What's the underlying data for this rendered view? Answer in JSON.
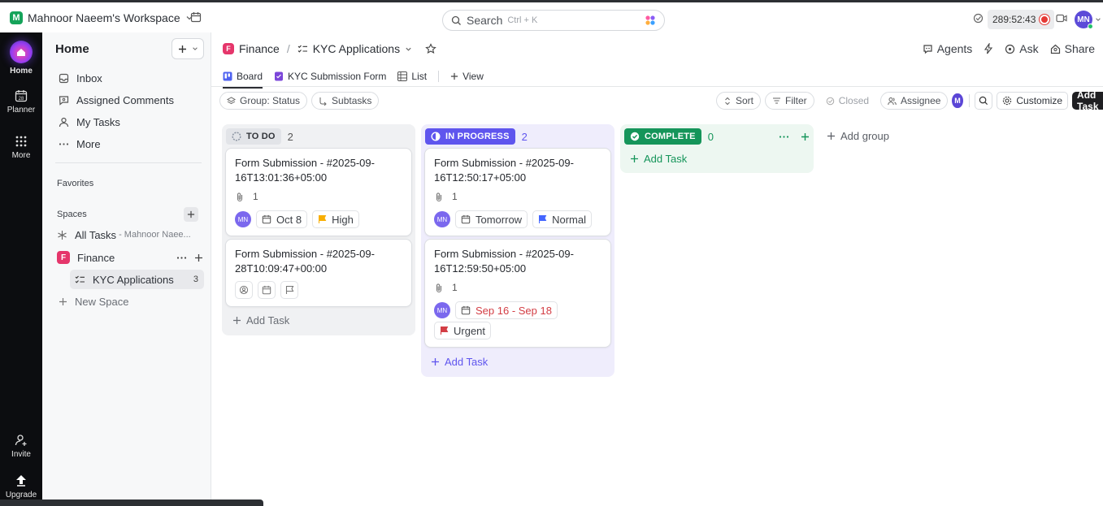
{
  "workspace": {
    "badge": "M",
    "name": "Mahnoor Naeem's Workspace"
  },
  "search": {
    "placeholder": "Search",
    "shortcut": "Ctrl + K"
  },
  "timer": {
    "value": "289:52:43"
  },
  "user": {
    "initials": "MN"
  },
  "rail": {
    "items": [
      {
        "label": "Home"
      },
      {
        "label": "Planner",
        "date": "28"
      },
      {
        "label": "More"
      },
      {
        "label": "Invite"
      },
      {
        "label": "Upgrade"
      }
    ]
  },
  "sidebar": {
    "title": "Home",
    "nav": [
      {
        "label": "Inbox"
      },
      {
        "label": "Assigned Comments"
      },
      {
        "label": "My Tasks"
      },
      {
        "label": "More"
      }
    ],
    "favorites_label": "Favorites",
    "spaces_label": "Spaces",
    "all_tasks": {
      "label": "All Tasks",
      "sub": "- Mahnoor Naee..."
    },
    "finance": {
      "badge": "F",
      "label": "Finance"
    },
    "kyc": {
      "label": "KYC Applications",
      "count": "3"
    },
    "new_space": "New Space"
  },
  "breadcrumb": {
    "space_badge": "F",
    "space": "Finance",
    "sep": "/",
    "list": "KYC Applications"
  },
  "header_actions": {
    "agents": "Agents",
    "ask": "Ask",
    "share": "Share"
  },
  "tabs": [
    {
      "label": "Board"
    },
    {
      "label": "KYC Submission Form"
    },
    {
      "label": "List"
    },
    {
      "label": "View"
    }
  ],
  "toolbar": {
    "group": "Group: Status",
    "subtasks": "Subtasks",
    "sort": "Sort",
    "filter": "Filter",
    "closed": "Closed",
    "assignee": "Assignee",
    "me_badge": "M",
    "customize": "Customize",
    "add_task": "Add Task"
  },
  "columns": [
    {
      "status": "TO DO",
      "count": "2",
      "add_task": "Add Task",
      "cards": [
        {
          "title": "Form Submission - #2025-09-16T13:01:36+05:00",
          "attachments": "1",
          "assignee": "MN",
          "date": "Oct 8",
          "priority": "High"
        },
        {
          "title": "Form Submission - #2025-09-28T10:09:47+00:00"
        }
      ]
    },
    {
      "status": "IN PROGRESS",
      "count": "2",
      "add_task": "Add Task",
      "cards": [
        {
          "title": "Form Submission - #2025-09-16T12:50:17+05:00",
          "attachments": "1",
          "assignee": "MN",
          "date": "Tomorrow",
          "priority": "Normal"
        },
        {
          "title": "Form Submission - #2025-09-16T12:59:50+05:00",
          "attachments": "1",
          "assignee": "MN",
          "date": "Sep 16 - Sep 18",
          "priority": "Urgent"
        }
      ]
    },
    {
      "status": "COMPLETE",
      "count": "0",
      "add_task": "Add Task"
    }
  ],
  "add_group": "Add group",
  "colors": {
    "todo": "#87909e",
    "inprogress": "#5f55ee",
    "complete": "#0f9d58",
    "high": "#f8ae00",
    "normal": "#4466ff",
    "urgent": "#d33d44",
    "overdue": "#d33d44"
  }
}
